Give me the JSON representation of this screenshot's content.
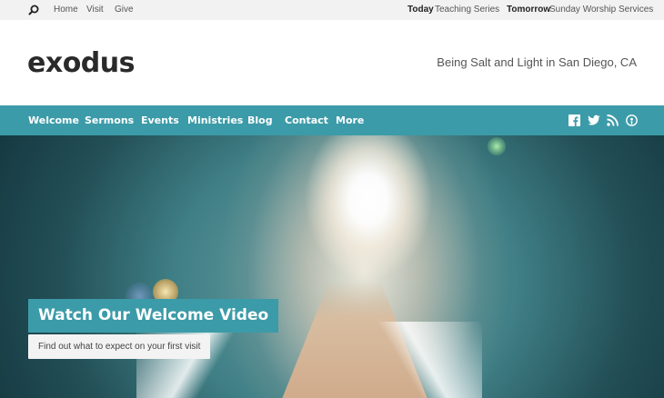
{
  "topbar": {
    "search_icon": "search-icon",
    "links": [
      "Home",
      "Visit",
      "Give"
    ],
    "today_label": "Today",
    "today_value": "Teaching Series",
    "tomorrow_label": "Tomorrow",
    "tomorrow_value": "Sunday Worship Services"
  },
  "header": {
    "logo": "exodus",
    "tagline": "Being Salt and Light in San Diego, CA"
  },
  "nav": {
    "items": [
      "Welcome",
      "Sermons",
      "Events",
      "Ministries",
      "Blog",
      "Contact",
      "More"
    ],
    "social_icons": [
      "facebook-icon",
      "twitter-icon",
      "rss-icon",
      "podcast-icon"
    ],
    "accent": "#3c9ba8"
  },
  "hero": {
    "title": "Watch Our Welcome Video",
    "subtitle": "Find out what to expect on your first visit"
  }
}
